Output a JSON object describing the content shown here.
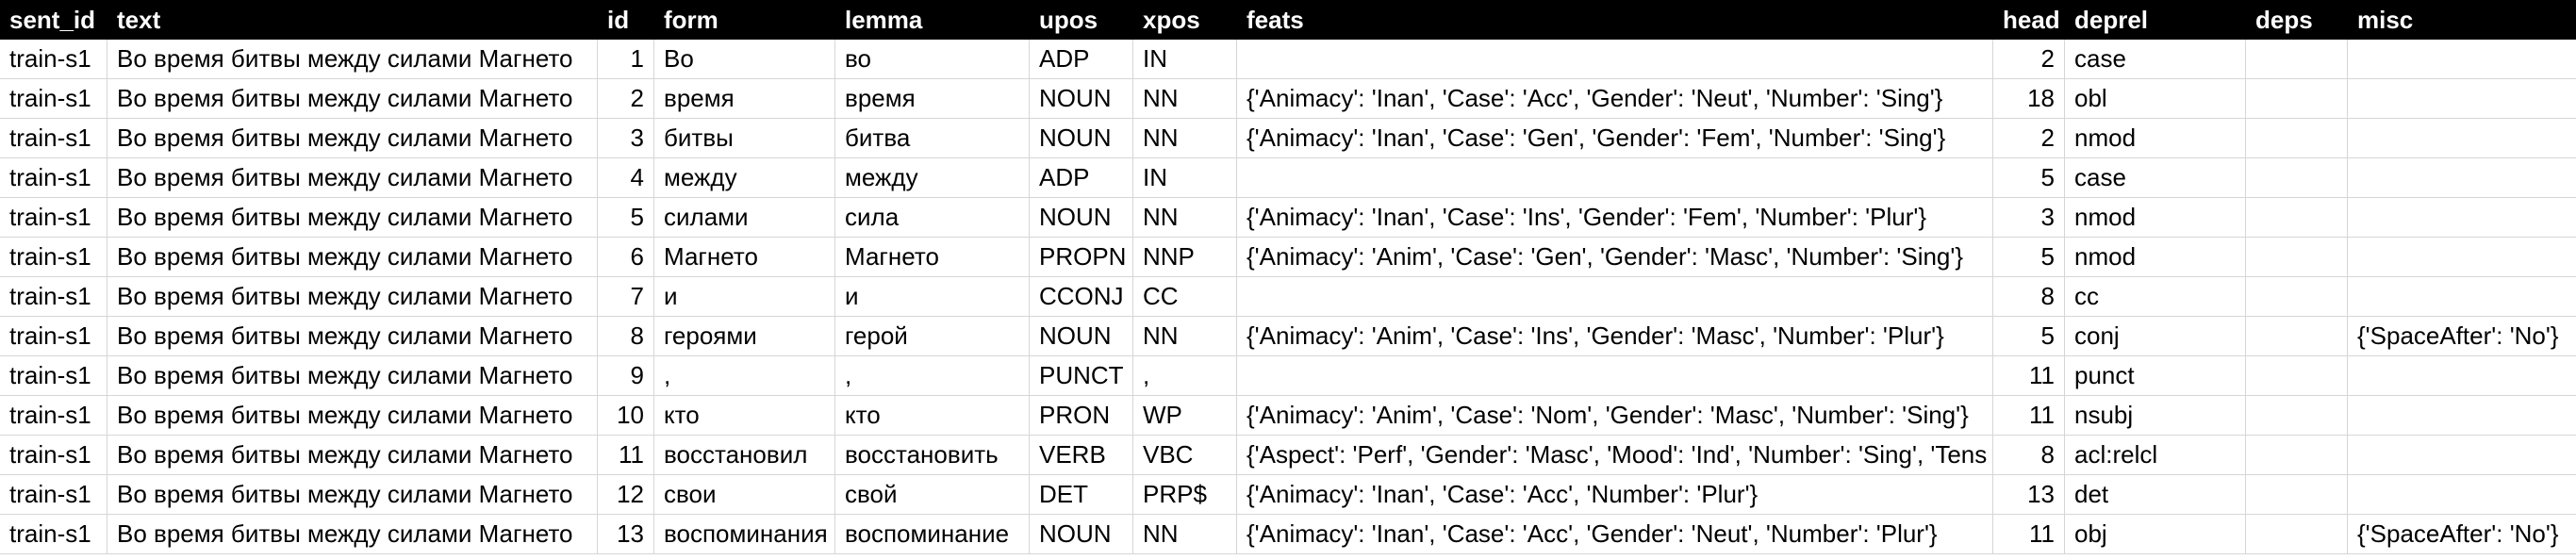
{
  "columns": [
    "sent_id",
    "text",
    "id",
    "form",
    "lemma",
    "upos",
    "xpos",
    "feats",
    "head",
    "deprel",
    "deps",
    "misc"
  ],
  "rows": [
    {
      "sent_id": "train-s1",
      "text": "Во время битвы между силами Магнето",
      "id": "1",
      "form": "Во",
      "lemma": "во",
      "upos": "ADP",
      "xpos": "IN",
      "feats": "",
      "head": "2",
      "deprel": "case",
      "deps": "",
      "misc": ""
    },
    {
      "sent_id": "train-s1",
      "text": "Во время битвы между силами Магнето",
      "id": "2",
      "form": "время",
      "lemma": "время",
      "upos": "NOUN",
      "xpos": "NN",
      "feats": "{'Animacy': 'Inan', 'Case': 'Acc', 'Gender': 'Neut', 'Number': 'Sing'}",
      "head": "18",
      "deprel": "obl",
      "deps": "",
      "misc": ""
    },
    {
      "sent_id": "train-s1",
      "text": "Во время битвы между силами Магнето",
      "id": "3",
      "form": "битвы",
      "lemma": "битва",
      "upos": "NOUN",
      "xpos": "NN",
      "feats": "{'Animacy': 'Inan', 'Case': 'Gen', 'Gender': 'Fem', 'Number': 'Sing'}",
      "head": "2",
      "deprel": "nmod",
      "deps": "",
      "misc": ""
    },
    {
      "sent_id": "train-s1",
      "text": "Во время битвы между силами Магнето",
      "id": "4",
      "form": "между",
      "lemma": "между",
      "upos": "ADP",
      "xpos": "IN",
      "feats": "",
      "head": "5",
      "deprel": "case",
      "deps": "",
      "misc": ""
    },
    {
      "sent_id": "train-s1",
      "text": "Во время битвы между силами Магнето",
      "id": "5",
      "form": "силами",
      "lemma": "сила",
      "upos": "NOUN",
      "xpos": "NN",
      "feats": "{'Animacy': 'Inan', 'Case': 'Ins', 'Gender': 'Fem', 'Number': 'Plur'}",
      "head": "3",
      "deprel": "nmod",
      "deps": "",
      "misc": ""
    },
    {
      "sent_id": "train-s1",
      "text": "Во время битвы между силами Магнето",
      "id": "6",
      "form": "Магнето",
      "lemma": "Магнето",
      "upos": "PROPN",
      "xpos": "NNP",
      "feats": "{'Animacy': 'Anim', 'Case': 'Gen', 'Gender': 'Masc', 'Number': 'Sing'}",
      "head": "5",
      "deprel": "nmod",
      "deps": "",
      "misc": ""
    },
    {
      "sent_id": "train-s1",
      "text": "Во время битвы между силами Магнето",
      "id": "7",
      "form": "и",
      "lemma": "и",
      "upos": "CCONJ",
      "xpos": "CC",
      "feats": "",
      "head": "8",
      "deprel": "cc",
      "deps": "",
      "misc": ""
    },
    {
      "sent_id": "train-s1",
      "text": "Во время битвы между силами Магнето",
      "id": "8",
      "form": "героями",
      "lemma": "герой",
      "upos": "NOUN",
      "xpos": "NN",
      "feats": "{'Animacy': 'Anim', 'Case': 'Ins', 'Gender': 'Masc', 'Number': 'Plur'}",
      "head": "5",
      "deprel": "conj",
      "deps": "",
      "misc": "{'SpaceAfter': 'No'}"
    },
    {
      "sent_id": "train-s1",
      "text": "Во время битвы между силами Магнето",
      "id": "9",
      "form": ",",
      "lemma": ",",
      "upos": "PUNCT",
      "xpos": ",",
      "feats": "",
      "head": "11",
      "deprel": "punct",
      "deps": "",
      "misc": ""
    },
    {
      "sent_id": "train-s1",
      "text": "Во время битвы между силами Магнето",
      "id": "10",
      "form": "кто",
      "lemma": "кто",
      "upos": "PRON",
      "xpos": "WP",
      "feats": "{'Animacy': 'Anim', 'Case': 'Nom', 'Gender': 'Masc', 'Number': 'Sing'}",
      "head": "11",
      "deprel": "nsubj",
      "deps": "",
      "misc": ""
    },
    {
      "sent_id": "train-s1",
      "text": "Во время битвы между силами Магнето",
      "id": "11",
      "form": "восстановил",
      "lemma": "восстановить",
      "upos": "VERB",
      "xpos": "VBC",
      "feats": "{'Aspect': 'Perf', 'Gender': 'Masc', 'Mood': 'Ind', 'Number': 'Sing', 'Tens",
      "head": "8",
      "deprel": "acl:relcl",
      "deps": "",
      "misc": ""
    },
    {
      "sent_id": "train-s1",
      "text": "Во время битвы между силами Магнето",
      "id": "12",
      "form": "свои",
      "lemma": "свой",
      "upos": "DET",
      "xpos": "PRP$",
      "feats": "{'Animacy': 'Inan', 'Case': 'Acc', 'Number': 'Plur'}",
      "head": "13",
      "deprel": "det",
      "deps": "",
      "misc": ""
    },
    {
      "sent_id": "train-s1",
      "text": "Во время битвы между силами Магнето",
      "id": "13",
      "form": "воспоминания",
      "lemma": "воспоминание",
      "upos": "NOUN",
      "xpos": "NN",
      "feats": "{'Animacy': 'Inan', 'Case': 'Acc', 'Gender': 'Neut', 'Number': 'Plur'}",
      "head": "11",
      "deprel": "obj",
      "deps": "",
      "misc": "{'SpaceAfter': 'No'}"
    }
  ]
}
